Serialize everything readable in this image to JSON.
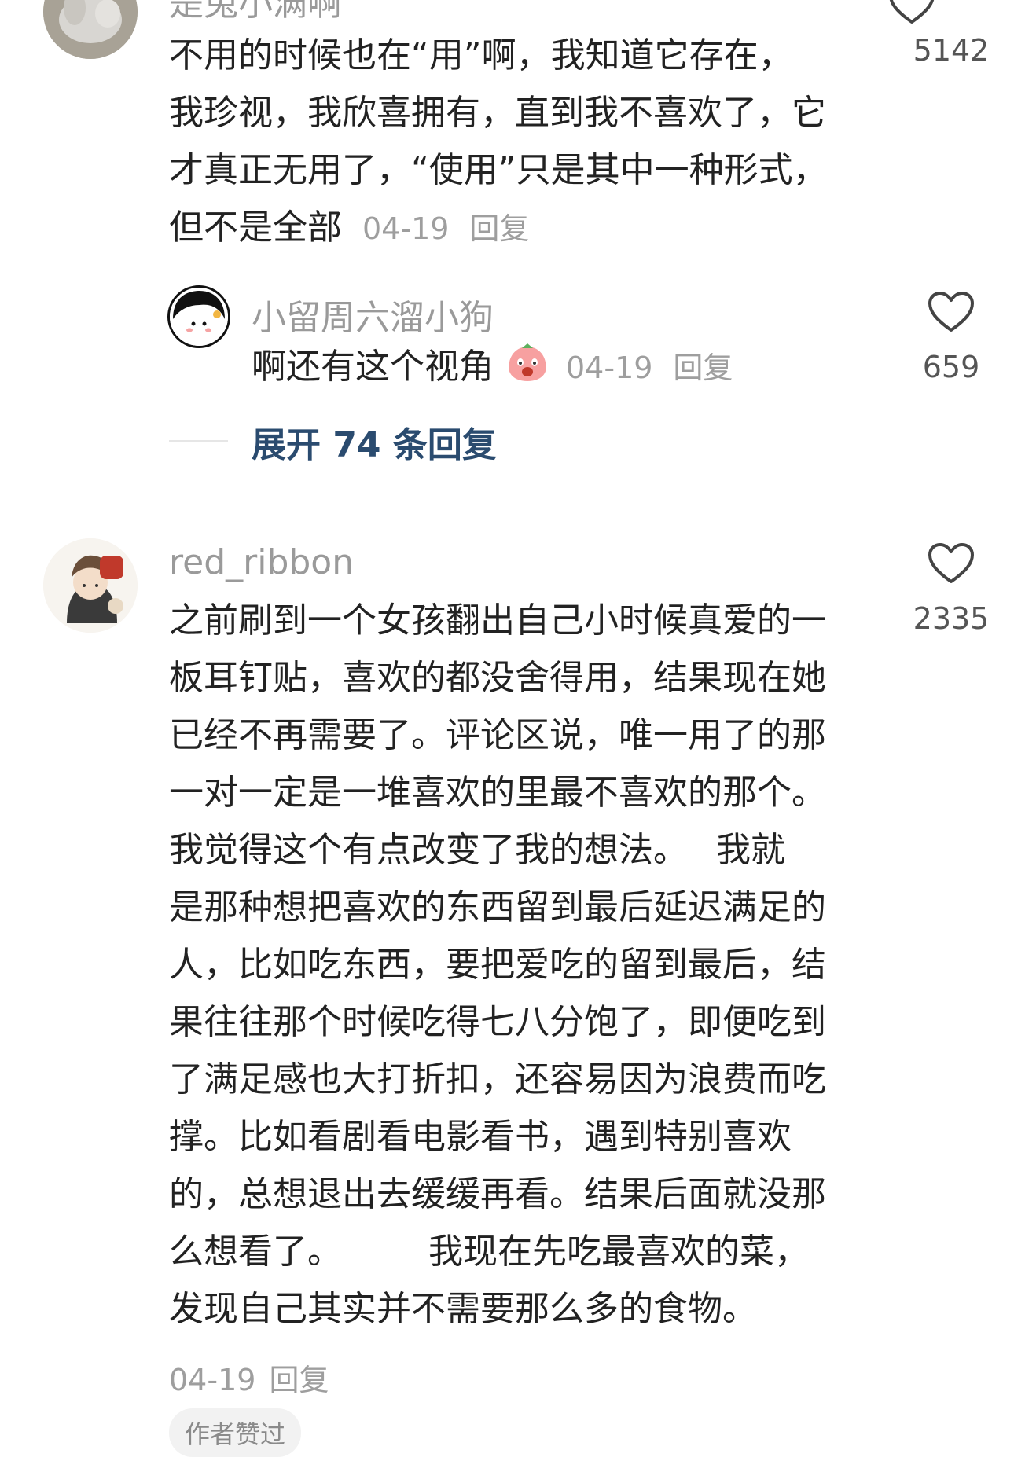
{
  "comment1": {
    "username": "是兔小满啊",
    "text_lines": [
      "不用的时候也在“用”啊，我知道它存在，",
      "我珍视，我欣喜拥有，直到我不喜欢了，它",
      "才真正无用了，“使用”只是其中一种形式，"
    ],
    "last_line": "但不是全部",
    "date": "04-19",
    "reply": "回复",
    "likes": "5142",
    "avatar_icon": "plush-toy-avatar-icon"
  },
  "reply1": {
    "username": "小留周六溜小狗",
    "text": "啊还有这个视角",
    "emoji_icon": "pink-blob-emoji-icon",
    "date": "04-19",
    "reply": "回复",
    "likes": "659",
    "avatar_icon": "cartoon-girl-avatar-icon"
  },
  "expand": {
    "label": "展开 74 条回复"
  },
  "comment2": {
    "username": "red_ribbon",
    "text_lines": [
      "之前刷到一个女孩翻出自己小时候真爱的一",
      "板耳钉贴，喜欢的都没舍得用，结果现在她",
      "已经不再需要了。评论区说，唯一用了的那",
      "一对一定是一堆喜欢的里最不喜欢的那个。",
      "我觉得这个有点改变了我的想法。　 我就",
      "是那种想把喜欢的东西留到最后延迟满足的",
      "人，比如吃东西，要把爱吃的留到最后，结",
      "果往往那个时候吃得七八分饱了，即便吃到",
      "了满足感也大打折扣，还容易因为浪费而吃",
      "撑。比如看剧看电影看书，遇到特别喜欢",
      "的，总想退出去缓缓再看。结果后面就没那",
      "么想看了。　　　我现在先吃最喜欢的菜，",
      "发现自己其实并不需要那么多的食物。"
    ],
    "date": "04-19",
    "reply": "回复",
    "likes": "2335",
    "badge": "作者赞过",
    "avatar_icon": "illustrated-girl-avatar-icon"
  },
  "colors": {
    "username": "#9a9a9a",
    "text": "#222222",
    "meta": "#9e9e9e",
    "expand": "#2a4b6f",
    "badge_bg": "#f2f2f2"
  }
}
